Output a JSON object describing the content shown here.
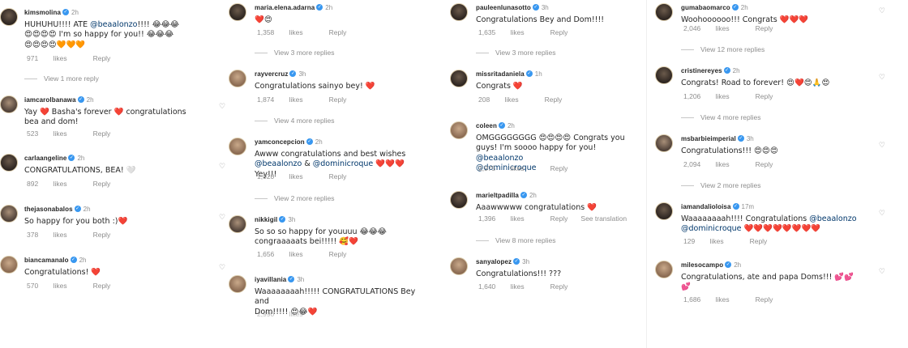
{
  "ui": {
    "verified_mark": "✓",
    "like_label": "likes",
    "reply_label": "Reply",
    "heart_icon": "♡"
  },
  "col1": {
    "c1": {
      "user": "kimsmolina",
      "time": "2h",
      "text1": "HUHUHU!!!! ATE",
      "mention": "@beaalonzo",
      "text2": "!!!! 😂😂😂",
      "text3": "😍😍😍😍 I'm so happy for you!! 😂😂😂",
      "text4": "😍😍😍😍🧡🧡🧡",
      "likes": "971"
    },
    "c1_replies": "View 1 more reply",
    "c2": {
      "user": "iamcarolbanawa",
      "time": "2h",
      "text1": "Yay ❤️ Basha's forever ❤️ congratulations",
      "text2": "bea and dom!",
      "likes": "523"
    },
    "c3": {
      "user": "carlaangeline",
      "time": "2h",
      "text1": "CONGRATULATIONS, BEA! 🤍",
      "likes": "892"
    },
    "c4": {
      "user": "thejasonabalos",
      "time": "2h",
      "text1": "So happy for you both :)❤️",
      "likes": "378"
    },
    "c5": {
      "user": "biancamanalo",
      "time": "2h",
      "text1": "Congratulations! ❤️",
      "likes": "570"
    }
  },
  "col2": {
    "c1": {
      "user": "maria.elena.adarna",
      "time": "2h",
      "text1": "❤️😍",
      "likes": "1,358"
    },
    "c1_replies": "View 3 more replies",
    "c2": {
      "user": "rayvercruz",
      "time": "3h",
      "text1": "Congratulations sainyo bey! ❤️",
      "likes": "1,874"
    },
    "c2_replies": "View 4 more replies",
    "c3": {
      "user": "yamconcepcion",
      "time": "2h",
      "text1": "Awww congratulations and best wishes",
      "mention1": "@beaalonzo",
      "mid": " & ",
      "mention2": "@dominicroque",
      "text2": " ❤️❤️❤️ Yey!!!",
      "likes": "1,020"
    },
    "c3_replies": "View 2 more replies",
    "c4": {
      "user": "nikkigil",
      "time": "3h",
      "text1": "So so so happy for youuuu 😂😂😂",
      "text2": "congraaaaats bei!!!!! 🥰❤️",
      "likes": "1,656"
    },
    "c5": {
      "user": "iyavillania",
      "time": "3h",
      "text1": "Waaaaaaaah!!!!! CONGRATULATIONS Bey and",
      "text2": "Dom!!!!! 😍😂❤️",
      "likes": "2,990"
    }
  },
  "col3": {
    "c1": {
      "user": "pauleenlunasotto",
      "time": "3h",
      "text1": "Congratulations Bey and Dom!!!!",
      "likes": "1,635"
    },
    "c1_replies": "View 3 more replies",
    "c2": {
      "user": "missritadaniela",
      "time": "1h",
      "text1": "Congrats ❤️",
      "likes": "208"
    },
    "c3": {
      "user": "coleen",
      "time": "2h",
      "text1": "OMGGGGGGGG 😍😍😍😍 Congrats you",
      "text2": "guys! I'm soooo happy for you!",
      "mention1": "@beaalonzo",
      "mention2": "@dominicroque",
      "likes": "2,975"
    },
    "c4": {
      "user": "marieltpadilla",
      "time": "2h",
      "text1": "Aaawwwww congratulations ❤️",
      "likes": "1,396",
      "translate": "See translation"
    },
    "c4_replies": "View 8 more replies",
    "c5": {
      "user": "sanyalopez",
      "time": "3h",
      "text1": "Congratulations!!! ???",
      "likes": "1,640"
    }
  },
  "col4": {
    "c1": {
      "user": "gumabaomarco",
      "time": "2h",
      "text1": "Woohoooooo!!! Congrats ❤️❤️❤️",
      "likes": "2,046"
    },
    "c1_replies": "View 12 more replies",
    "c2": {
      "user": "cristinereyes",
      "time": "2h",
      "text1": "Congrats! Road to forever! 😍❤️😍🙏😍",
      "likes": "1,206"
    },
    "c2_replies": "View 4 more replies",
    "c3": {
      "user": "msbarbieimperial",
      "time": "3h",
      "text1": "Congratulations!!! 😍😍😍",
      "likes": "2,094"
    },
    "c3_replies": "View 2 more replies",
    "c4": {
      "user": "iamandalioloisa",
      "time": "17m",
      "text1": "Waaaaaaaah!!!! Congratulations",
      "mention1": "@beaalonzo",
      "mention2": "@dominicroque",
      "text2": " ❤️❤️❤️❤️❤️❤️❤️❤️",
      "likes": "129"
    },
    "c5": {
      "user": "milesocampo",
      "time": "2h",
      "text1": "Congratulations, ate and papa Doms!!! 💕💕",
      "text2": "💕",
      "likes": "1,686"
    }
  }
}
